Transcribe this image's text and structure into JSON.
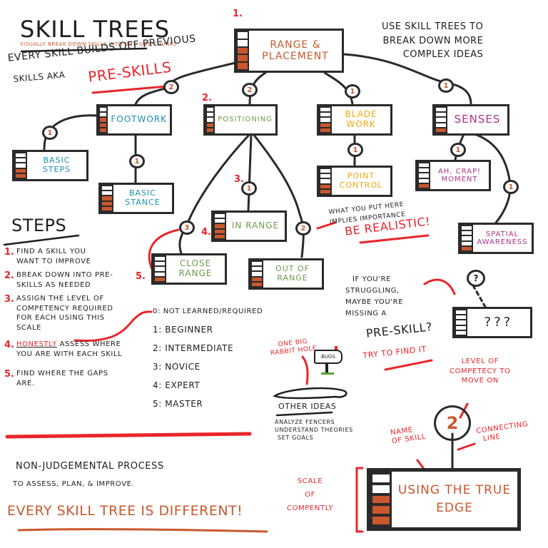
{
  "header": {
    "title": "Skill Trees",
    "subtitle": "Visually break down skills into bite size chunks",
    "intro_line1": "Every skill builds off previous",
    "intro_line2": "skills aka",
    "intro_highlight": "Pre-Skills",
    "side_note": [
      "Use skill trees to",
      "break down more",
      "complex ideas"
    ]
  },
  "colors": {
    "filled_bar": "#c9582e",
    "accent_red": "#e8262b",
    "outline": "#2a2a2a",
    "footwork_blue": "#1b8fb3",
    "positioning_green": "#6e9b4e",
    "blade_yellow": "#f2a90f",
    "senses_purple": "#b0318c",
    "range_orange": "#c9582e"
  },
  "scale_levels": 5,
  "nodes": {
    "range_placement": {
      "step": "1.",
      "label": "Range & Placement",
      "filled": 3
    },
    "footwork": {
      "label": "Footwork",
      "filled": 3,
      "connector": "2"
    },
    "positioning": {
      "step": "2.",
      "label": "Positioning",
      "filled": 2,
      "connector": "2"
    },
    "blade_work": {
      "label": "Blade Work",
      "filled": 2,
      "connector": "1"
    },
    "senses": {
      "label": "Senses",
      "filled": 1,
      "connector": "1"
    },
    "basic_steps": {
      "label": "Basic Steps",
      "filled": 2,
      "connector": "1"
    },
    "basic_stance": {
      "label": "Basic Stance",
      "filled": 3,
      "connector": "1"
    },
    "point_control": {
      "label": "Point Control",
      "filled": 2,
      "connector": "1"
    },
    "ah_crap_moment": {
      "label": "Ah, Crap! Moment",
      "filled": 1,
      "connector": "1"
    },
    "spatial_awareness": {
      "label": "Spatial Awareness",
      "filled": 1,
      "connector": "1"
    },
    "in_range": {
      "step_before": "3.",
      "step_after": "4.",
      "label": "In Range",
      "filled": 3,
      "connector": "1"
    },
    "close_range": {
      "step": "5.",
      "label": "Close Range",
      "filled": 1,
      "connector": "3"
    },
    "out_of_range": {
      "label": "Out of Range",
      "filled": 2,
      "connector": "2"
    },
    "missing": {
      "label": "???",
      "filled": 0,
      "connector": "?"
    },
    "legend_example": {
      "label": "Using the True Edge",
      "filled": 3,
      "connector": "2"
    }
  },
  "importance_note": {
    "line1": "What you put here",
    "line2": "implies importance",
    "emphasis": "Be Realistic!"
  },
  "steps": {
    "title": "Steps",
    "items": [
      {
        "num": "1.",
        "text": "Find a skill you want to improve"
      },
      {
        "num": "2.",
        "text": "Break down into pre-skills as needed"
      },
      {
        "num": "3.",
        "text": "Assign the level of competency required for each using this scale"
      },
      {
        "num": "4.",
        "emphasis": "Honestly",
        "text": "assess where you are with each skill"
      },
      {
        "num": "5.",
        "text": "Find where the gaps are."
      }
    ]
  },
  "scale": [
    "0: Not Learned/Required",
    "1: Beginner",
    "2: Intermediate",
    "3: Novice",
    "4: Expert",
    "5: Master"
  ],
  "struggling_note": {
    "lines": [
      "If you're",
      "struggling,",
      "maybe you're",
      "missing a"
    ],
    "big": "Pre-Skill?",
    "call_to_action": "Try to find it"
  },
  "rabbit_hole": {
    "caption": "One big rabbit hole",
    "mailbox_label": "Bugs",
    "other_title": "Other Ideas",
    "other_items": [
      "Analyze Fencers",
      "Understand Theories",
      "Set Goals"
    ]
  },
  "legend": {
    "level_note": [
      "Level of",
      "competecy to",
      "move on"
    ],
    "name_note": [
      "Name",
      "of skill"
    ],
    "line_note": [
      "Connecting",
      "line"
    ],
    "scale_note": [
      "Scale",
      "of",
      "compently"
    ]
  },
  "footer": {
    "line1": "Non-Judgemental Process",
    "line2": "to assess, plan, & improve.",
    "tagline": "Every skill tree is Different!"
  }
}
